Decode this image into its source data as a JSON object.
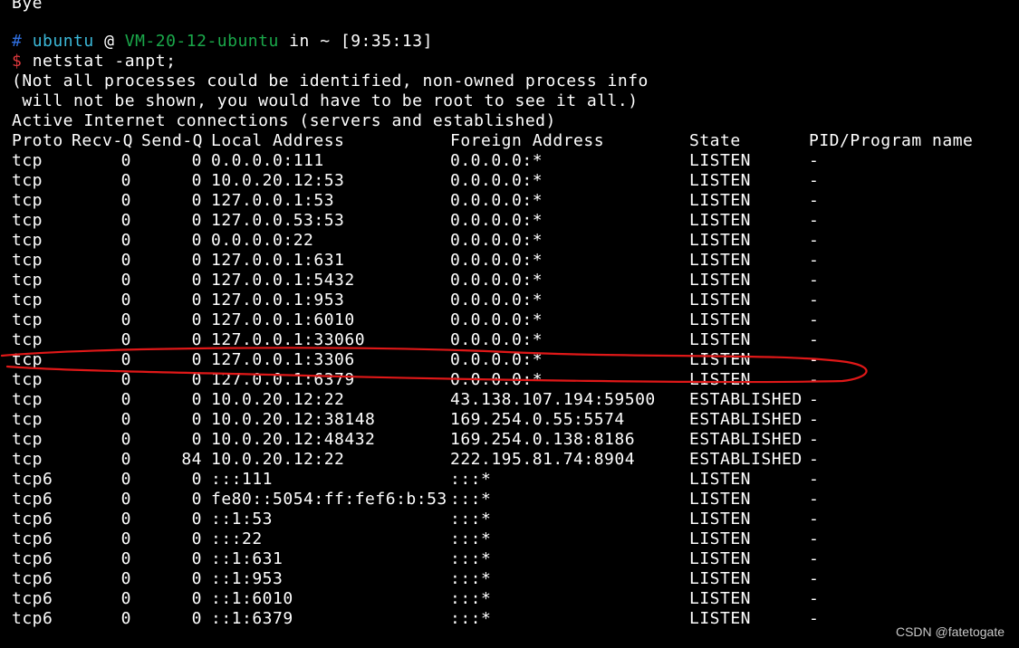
{
  "top_fragment": "Bye",
  "prompt": {
    "hash": "#",
    "user": "ubuntu",
    "at": "@",
    "host": "VM-20-12-ubuntu",
    "in": "in",
    "dir": "~",
    "time": "[9:35:13]",
    "dollar": "$",
    "command": "netstat -anpt;"
  },
  "notice": [
    "(Not all processes could be identified, non-owned process info",
    " will not be shown, you would have to be root to see it all.)",
    "Active Internet connections (servers and established)"
  ],
  "table": {
    "headers": [
      "Proto",
      "Recv-Q",
      "Send-Q",
      "Local Address",
      "Foreign Address",
      "State",
      "PID/Program name"
    ],
    "rows": [
      [
        "tcp",
        "0",
        "0",
        "0.0.0.0:111",
        "0.0.0.0:*",
        "LISTEN",
        "-"
      ],
      [
        "tcp",
        "0",
        "0",
        "10.0.20.12:53",
        "0.0.0.0:*",
        "LISTEN",
        "-"
      ],
      [
        "tcp",
        "0",
        "0",
        "127.0.0.1:53",
        "0.0.0.0:*",
        "LISTEN",
        "-"
      ],
      [
        "tcp",
        "0",
        "0",
        "127.0.0.53:53",
        "0.0.0.0:*",
        "LISTEN",
        "-"
      ],
      [
        "tcp",
        "0",
        "0",
        "0.0.0.0:22",
        "0.0.0.0:*",
        "LISTEN",
        "-"
      ],
      [
        "tcp",
        "0",
        "0",
        "127.0.0.1:631",
        "0.0.0.0:*",
        "LISTEN",
        "-"
      ],
      [
        "tcp",
        "0",
        "0",
        "127.0.0.1:5432",
        "0.0.0.0:*",
        "LISTEN",
        "-"
      ],
      [
        "tcp",
        "0",
        "0",
        "127.0.0.1:953",
        "0.0.0.0:*",
        "LISTEN",
        "-"
      ],
      [
        "tcp",
        "0",
        "0",
        "127.0.0.1:6010",
        "0.0.0.0:*",
        "LISTEN",
        "-"
      ],
      [
        "tcp",
        "0",
        "0",
        "127.0.0.1:33060",
        "0.0.0.0:*",
        "LISTEN",
        "-"
      ],
      [
        "tcp",
        "0",
        "0",
        "127.0.0.1:3306",
        "0.0.0.0:*",
        "LISTEN",
        "-"
      ],
      [
        "tcp",
        "0",
        "0",
        "127.0.0.1:6379",
        "0.0.0.0:*",
        "LISTEN",
        "-"
      ],
      [
        "tcp",
        "0",
        "0",
        "10.0.20.12:22",
        "43.138.107.194:59500",
        "ESTABLISHED",
        "-"
      ],
      [
        "tcp",
        "0",
        "0",
        "10.0.20.12:38148",
        "169.254.0.55:5574",
        "ESTABLISHED",
        "-"
      ],
      [
        "tcp",
        "0",
        "0",
        "10.0.20.12:48432",
        "169.254.0.138:8186",
        "ESTABLISHED",
        "-"
      ],
      [
        "tcp",
        "0",
        "84",
        "10.0.20.12:22",
        "222.195.81.74:8904",
        "ESTABLISHED",
        "-"
      ],
      [
        "tcp6",
        "0",
        "0",
        ":::111",
        ":::*",
        "LISTEN",
        "-"
      ],
      [
        "tcp6",
        "0",
        "0",
        "fe80::5054:ff:fef6:b:53",
        ":::*",
        "LISTEN",
        "-"
      ],
      [
        "tcp6",
        "0",
        "0",
        "::1:53",
        ":::*",
        "LISTEN",
        "-"
      ],
      [
        "tcp6",
        "0",
        "0",
        ":::22",
        ":::*",
        "LISTEN",
        "-"
      ],
      [
        "tcp6",
        "0",
        "0",
        "::1:631",
        ":::*",
        "LISTEN",
        "-"
      ],
      [
        "tcp6",
        "0",
        "0",
        "::1:953",
        ":::*",
        "LISTEN",
        "-"
      ],
      [
        "tcp6",
        "0",
        "0",
        "::1:6010",
        ":::*",
        "LISTEN",
        "-"
      ],
      [
        "tcp6",
        "0",
        "0",
        "::1:6379",
        ":::*",
        "LISTEN",
        "-"
      ]
    ]
  },
  "highlight": {
    "row_index": 10,
    "color": "#e01818"
  },
  "watermark": "CSDN @fatetogate",
  "colors": {
    "background": "#000000",
    "text": "#ffffff",
    "prompt_hash": "#2f6fe0",
    "prompt_user": "#3bb8d8",
    "prompt_host": "#1aa84a",
    "prompt_dollar": "#e0393e"
  }
}
